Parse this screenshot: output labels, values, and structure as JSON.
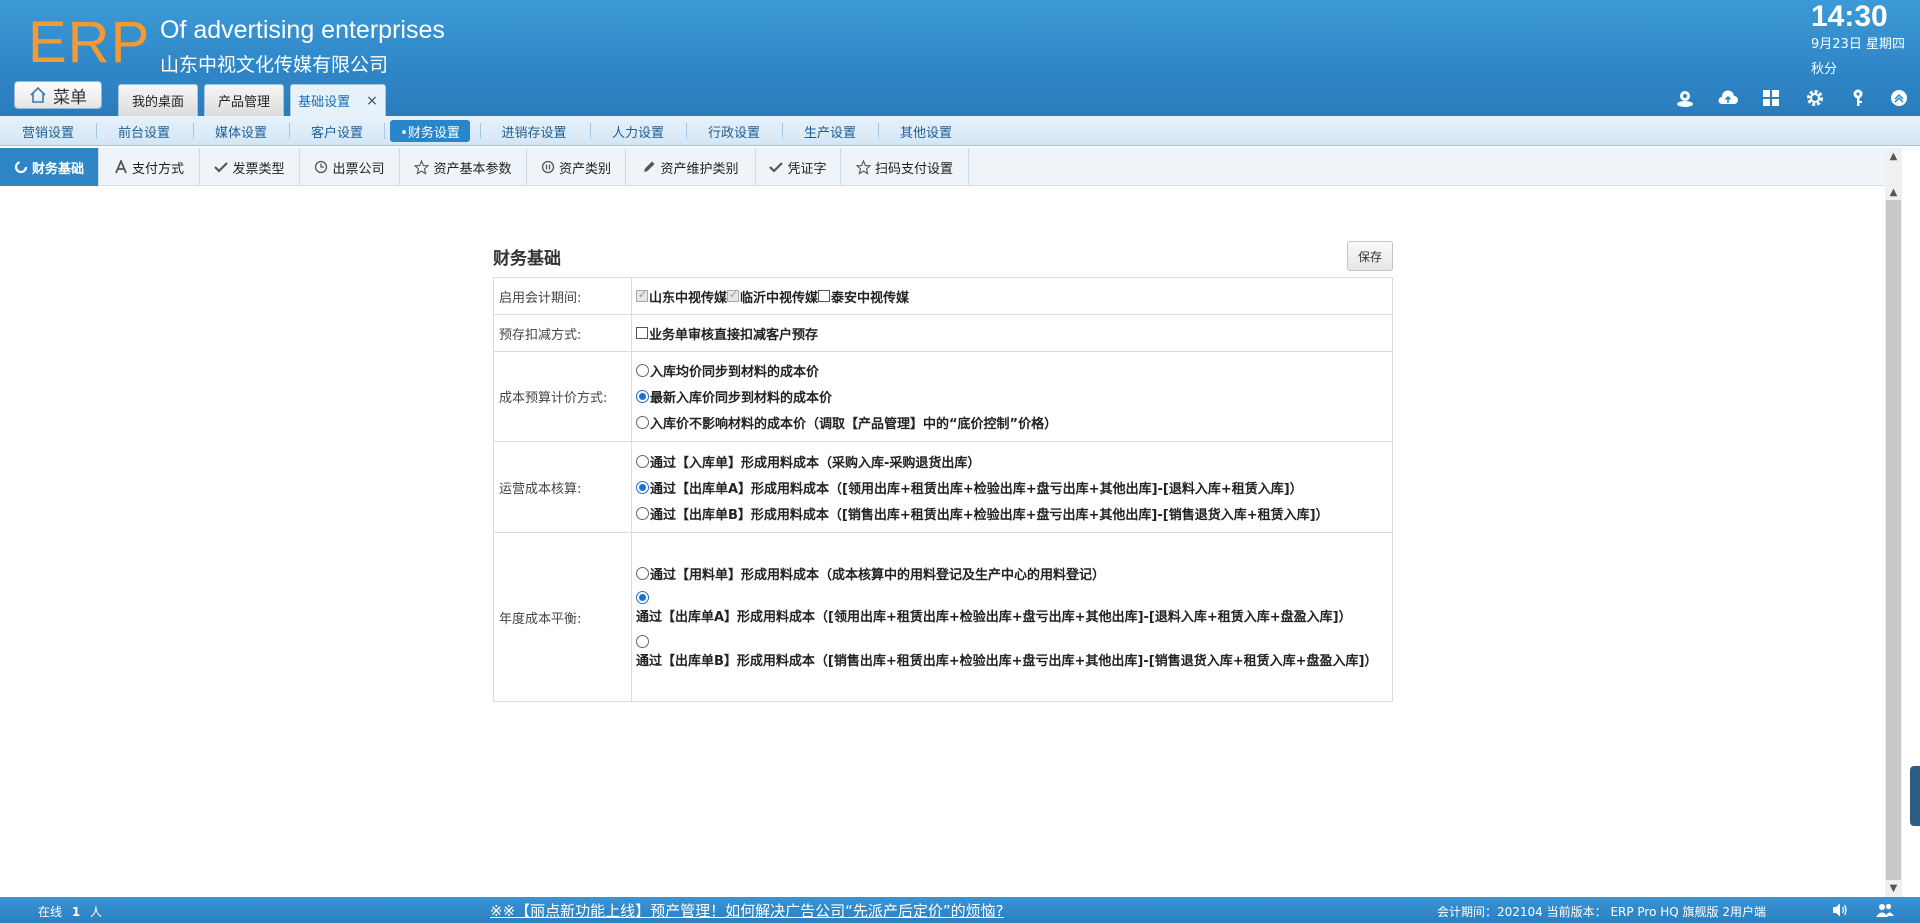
{
  "header": {
    "logo": "ERP",
    "company_en": "Of advertising enterprises",
    "company_cn": "山东中视文化传媒有限公司",
    "time": "14:30",
    "date": "9月23日 星期四",
    "term": "秋分",
    "menu_label": "菜单",
    "tabs": [
      {
        "label": "我的桌面"
      },
      {
        "label": "产品管理"
      },
      {
        "label": "基础设置",
        "close": "×"
      }
    ],
    "icons": [
      "user-icon",
      "cloud-icon",
      "apps-icon",
      "gear-icon",
      "key-icon",
      "collapse-up-icon"
    ]
  },
  "nav2": {
    "items": [
      "营销设置",
      "前台设置",
      "媒体设置",
      "客户设置",
      "•财务设置",
      "进销存设置",
      "人力设置",
      "行政设置",
      "生产设置",
      "其他设置"
    ],
    "active": "•财务设置"
  },
  "nav3": {
    "items": [
      "财务基础",
      "支付方式",
      "发票类型",
      "出票公司",
      "资产基本参数",
      "资产类别",
      "资产维护类别",
      "凭证字",
      "扫码支付设置"
    ]
  },
  "panel": {
    "title": "财务基础",
    "save_label": "保存",
    "rows": {
      "period": {
        "label": "启用会计期间:",
        "options": [
          "山东中视传媒",
          "临沂中视传媒",
          "泰安中视传媒"
        ]
      },
      "deduct": {
        "label": "预存扣减方式:",
        "option": "业务单审核直接扣减客户预存"
      },
      "budget": {
        "label": "成本预算计价方式:",
        "options": [
          "入库均价同步到材料的成本价",
          "最新入库价同步到材料的成本价",
          "入库价不影响材料的成本价（调取【产品管理】中的“底价控制”价格）"
        ]
      },
      "ops": {
        "label": "运营成本核算:",
        "options": [
          "通过【入库单】形成用料成本（采购入库-采购退货出库）",
          "通过【出库单A】形成用料成本（[领用出库+租赁出库+检验出库+盘亏出库+其他出库]-[退料入库+租赁入库]）",
          "通过【出库单B】形成用料成本（[销售出库+租赁出库+检验出库+盘亏出库+其他出库]-[销售退货入库+租赁入库]）"
        ]
      },
      "annual": {
        "label": "年度成本平衡:",
        "options": [
          "通过【用料单】形成用料成本（成本核算中的用料登记及生产中心的用料登记）",
          "通过【出库单A】形成用料成本（[领用出库+租赁出库+检验出库+盘亏出库+其他出库]-[退料入库+租赁入库+盘盈入库]）",
          "通过【出库单B】形成用料成本（[销售出库+租赁出库+检验出库+盘亏出库+其他出库]-[销售退货入库+租赁入库+盘盈入库]）"
        ]
      }
    }
  },
  "statusbar": {
    "online_prefix": "在线",
    "online_count": "1",
    "online_suffix": "人",
    "announcement": "※※【丽点新功能上线】预产管理！如何解决广告公司“先派产后定价”的烦恼?",
    "sysinfo": "会计期间：202104 当前版本：  ERP Pro HQ 旗舰版 2用户端"
  },
  "colors": {
    "header_blue": "#2f86c7",
    "logo_orange": "#f39a32",
    "active_blue": "#2a86cb"
  }
}
